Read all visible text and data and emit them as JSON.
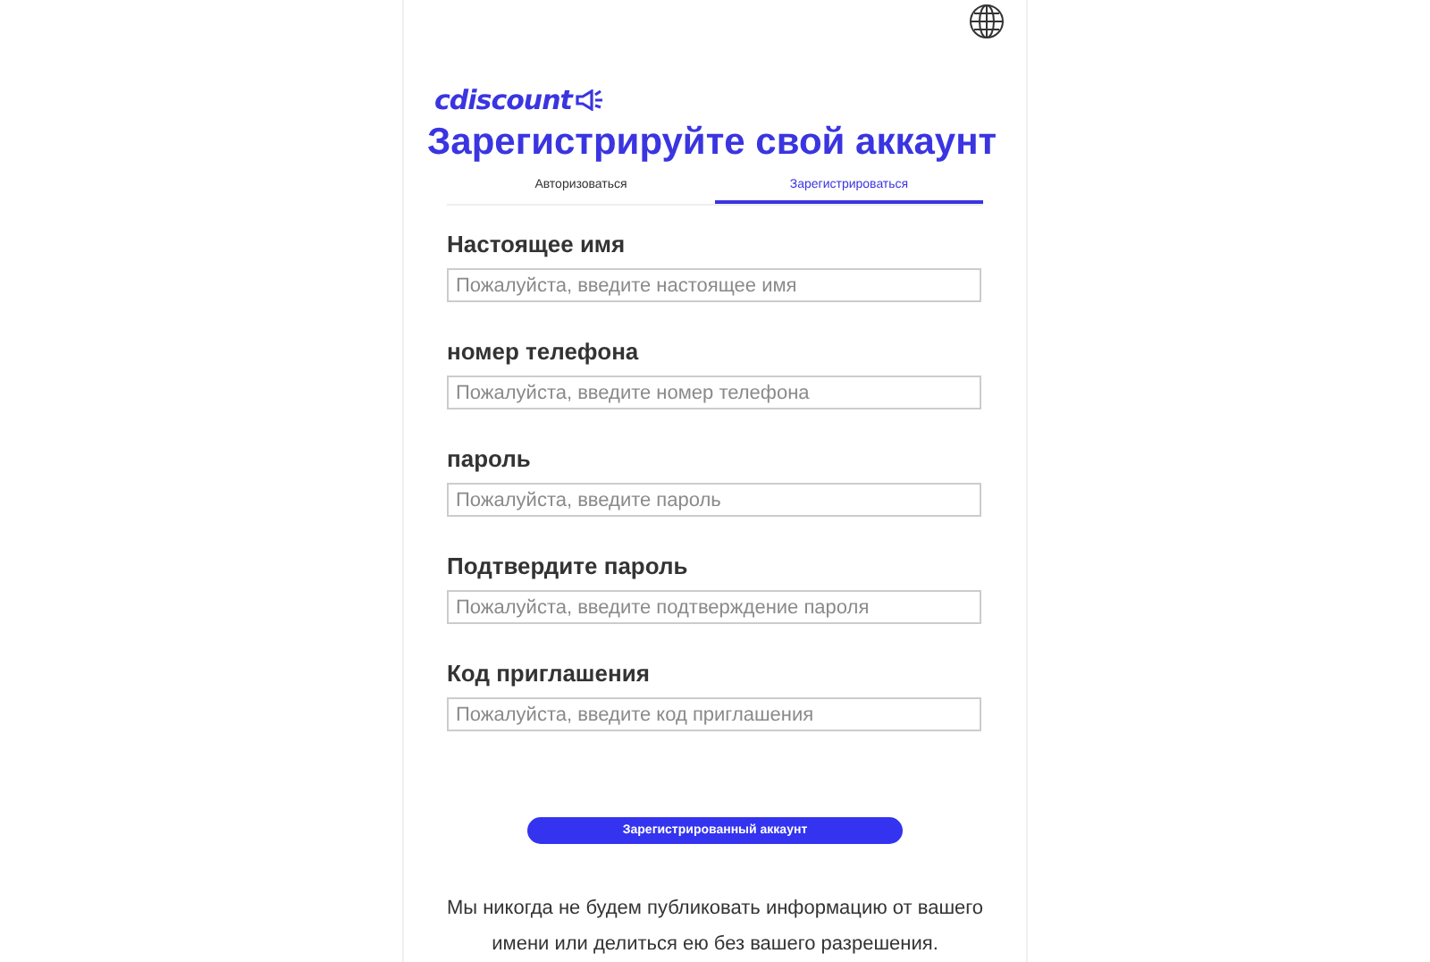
{
  "logo": {
    "text": "cdiscount"
  },
  "title": "Зарегистрируйте свой аккаунт",
  "tabs": [
    {
      "label": "Авторизоваться",
      "selected": false
    },
    {
      "label": "Зарегистрироваться",
      "selected": true
    }
  ],
  "fields": [
    {
      "label": "Настоящее имя",
      "placeholder": "Пожалуйста, введите настоящее имя"
    },
    {
      "label": "номер телефона",
      "placeholder": "Пожалуйста, введите номер телефона"
    },
    {
      "label": "пароль",
      "placeholder": "Пожалуйста, введите пароль"
    },
    {
      "label": "Подтвердите пароль",
      "placeholder": "Пожалуйста, введите подтверждение пароля"
    },
    {
      "label": "Код приглашения",
      "placeholder": "Пожалуйста, введите код приглашения"
    }
  ],
  "submit": "Зарегистрированный аккаунт",
  "notice": "Мы никогда не будем публиковать информацию от вашего имени или делиться ею без вашего разрешения."
}
